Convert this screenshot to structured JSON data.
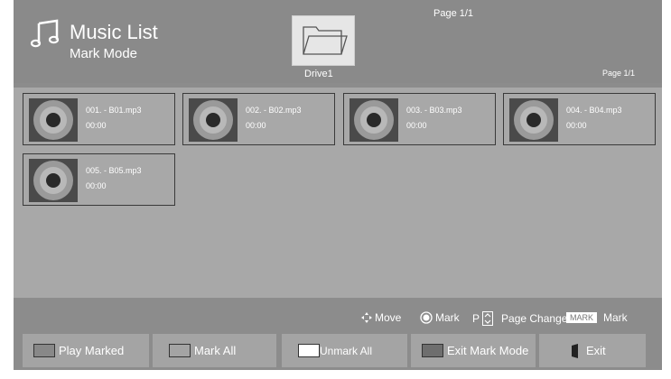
{
  "header": {
    "title": "Music List",
    "subtitle": "Mark Mode",
    "page_top": "Page 1/1",
    "drive_label": "Drive1",
    "page_right": "Page 1/1",
    "icon": "music-note-icon"
  },
  "items": [
    {
      "name": "001. - B01.mp3",
      "time": "00:00"
    },
    {
      "name": "002. - B02.mp3",
      "time": "00:00"
    },
    {
      "name": "003. - B03.mp3",
      "time": "00:00"
    },
    {
      "name": "004. - B04.mp3",
      "time": "00:00"
    },
    {
      "name": "005. - B05.mp3",
      "time": "00:00"
    }
  ],
  "legend": {
    "move": "Move",
    "mark": "Mark",
    "p": "P",
    "page_change": "Page Change",
    "mark_key": "MARK",
    "mark_text": "Mark"
  },
  "buttons": {
    "play_marked": "Play Marked",
    "mark_all": "Mark All",
    "unmark_all": "Unmark All",
    "exit_mark_mode": "Exit Mark Mode",
    "exit": "Exit"
  },
  "colors": {
    "background": "#8c8c8c",
    "list_background": "#a8a8a8",
    "button": "#a4a4a4",
    "text": "#ffffff"
  }
}
